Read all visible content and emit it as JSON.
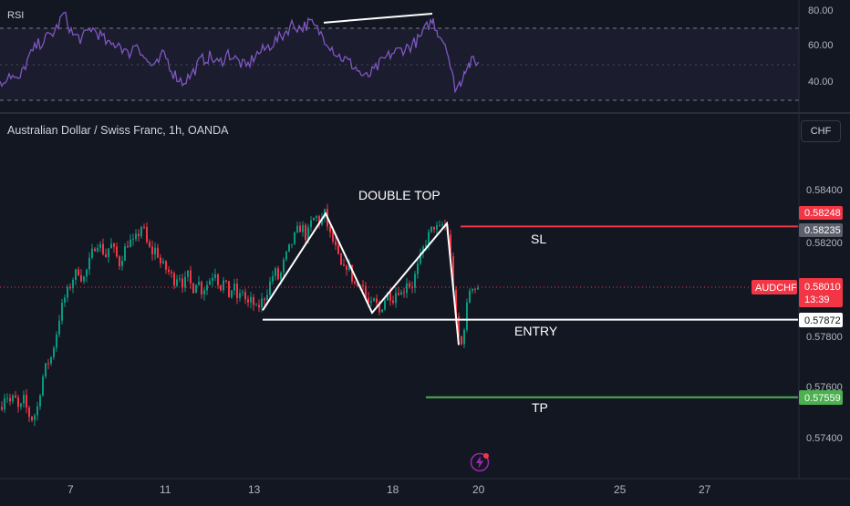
{
  "header": {
    "title": "Australian Dollar / Swiss Franc, 1h, OANDA",
    "currency_button": "CHF"
  },
  "rsi": {
    "label": "RSI",
    "ticks": [
      "80.00",
      "60.00",
      "40.00"
    ]
  },
  "price_axis": {
    "ticks": [
      "0.58400",
      "0.58200",
      "0.58000",
      "0.57800",
      "0.57600",
      "0.57400"
    ]
  },
  "price_tags": {
    "sl": {
      "value": "0.58248",
      "color": "#f23645"
    },
    "prev": {
      "value": "0.58235",
      "color": "#5d606b"
    },
    "current": {
      "symbol": "AUDCHF",
      "value": "0.58010",
      "countdown": "13:39",
      "color": "#f23645"
    },
    "entry": {
      "value": "0.57872"
    },
    "tp": {
      "value": "0.57559",
      "color": "#4caf50"
    }
  },
  "annotations": {
    "pattern": "DOUBLE TOP",
    "sl": "SL",
    "entry": "ENTRY",
    "tp": "TP"
  },
  "date_axis": {
    "ticks": [
      "7",
      "11",
      "13",
      "18",
      "20",
      "25",
      "27"
    ]
  },
  "colors": {
    "background": "#131722",
    "up": "#089981",
    "up_alt": "#26a69a",
    "down": "#f23645",
    "rsi_line": "#7e57c2",
    "rsi_band": "#7e57c2"
  },
  "icons": {
    "bolt": "lightning-bolt-icon"
  },
  "chart_data": {
    "type": "candlestick",
    "symbol": "AUDCHF",
    "timeframe": "1h",
    "source": "OANDA",
    "x_ticks": [
      "7",
      "11",
      "13",
      "18",
      "20",
      "25",
      "27"
    ],
    "ylim": [
      0.5732,
      0.585
    ],
    "price_path": [
      [
        0,
        0.5752
      ],
      [
        5,
        0.5758
      ],
      [
        10,
        0.5754
      ],
      [
        15,
        0.5756
      ],
      [
        20,
        0.575
      ],
      [
        25,
        0.5755
      ],
      [
        30,
        0.5749
      ],
      [
        35,
        0.5747
      ],
      [
        40,
        0.5752
      ],
      [
        45,
        0.5763
      ],
      [
        50,
        0.5769
      ],
      [
        55,
        0.5772
      ],
      [
        60,
        0.578
      ],
      [
        65,
        0.579
      ],
      [
        70,
        0.5796
      ],
      [
        75,
        0.58
      ],
      [
        80,
        0.5805
      ],
      [
        85,
        0.5807
      ],
      [
        90,
        0.5803
      ],
      [
        95,
        0.5808
      ],
      [
        100,
        0.5814
      ],
      [
        105,
        0.5819
      ],
      [
        110,
        0.5816
      ],
      [
        115,
        0.5813
      ],
      [
        120,
        0.5818
      ],
      [
        125,
        0.5814
      ],
      [
        130,
        0.581
      ],
      [
        135,
        0.5815
      ],
      [
        140,
        0.5819
      ],
      [
        145,
        0.5818
      ],
      [
        150,
        0.5821
      ],
      [
        155,
        0.5826
      ],
      [
        160,
        0.5818
      ],
      [
        165,
        0.5814
      ],
      [
        170,
        0.5816
      ],
      [
        175,
        0.581
      ],
      [
        180,
        0.5808
      ],
      [
        185,
        0.5806
      ],
      [
        190,
        0.5803
      ],
      [
        195,
        0.5806
      ],
      [
        200,
        0.5801
      ],
      [
        205,
        0.5805
      ],
      [
        210,
        0.5799
      ],
      [
        215,
        0.5804
      ],
      [
        220,
        0.5799
      ],
      [
        225,
        0.5801
      ],
      [
        230,
        0.5804
      ],
      [
        235,
        0.5807
      ],
      [
        240,
        0.58
      ],
      [
        245,
        0.5803
      ],
      [
        250,
        0.5797
      ],
      [
        255,
        0.5801
      ],
      [
        260,
        0.5795
      ],
      [
        265,
        0.5799
      ],
      [
        270,
        0.5793
      ],
      [
        275,
        0.5795
      ],
      [
        280,
        0.5791
      ],
      [
        285,
        0.5794
      ],
      [
        290,
        0.5797
      ],
      [
        295,
        0.5802
      ],
      [
        300,
        0.5807
      ],
      [
        305,
        0.5803
      ],
      [
        310,
        0.581
      ],
      [
        315,
        0.5815
      ],
      [
        320,
        0.5819
      ],
      [
        325,
        0.5823
      ],
      [
        330,
        0.5825
      ],
      [
        335,
        0.582
      ],
      [
        340,
        0.5826
      ],
      [
        345,
        0.5829
      ],
      [
        350,
        0.5826
      ],
      [
        355,
        0.583
      ],
      [
        360,
        0.5822
      ],
      [
        365,
        0.5818
      ],
      [
        370,
        0.5812
      ],
      [
        375,
        0.5806
      ],
      [
        380,
        0.581
      ],
      [
        385,
        0.5804
      ],
      [
        390,
        0.58
      ],
      [
        395,
        0.5804
      ],
      [
        400,
        0.5796
      ],
      [
        405,
        0.5792
      ],
      [
        410,
        0.5795
      ],
      [
        415,
        0.579
      ],
      [
        420,
        0.5795
      ],
      [
        425,
        0.5798
      ],
      [
        430,
        0.5796
      ],
      [
        435,
        0.58
      ],
      [
        440,
        0.5797
      ],
      [
        445,
        0.5803
      ],
      [
        450,
        0.58
      ],
      [
        455,
        0.5806
      ],
      [
        460,
        0.5812
      ],
      [
        465,
        0.5818
      ],
      [
        470,
        0.5822
      ],
      [
        475,
        0.5825
      ],
      [
        480,
        0.5823
      ],
      [
        485,
        0.5826
      ],
      [
        490,
        0.5822
      ],
      [
        495,
        0.5805
      ],
      [
        500,
        0.5782
      ],
      [
        505,
        0.5777
      ],
      [
        510,
        0.579
      ],
      [
        515,
        0.5802
      ],
      [
        520,
        0.58
      ],
      [
        525,
        0.5801
      ]
    ],
    "pattern_lines": {
      "double_top": [
        [
          288,
          0.5791
        ],
        [
          357,
          0.583
        ],
        [
          408,
          0.579
        ],
        [
          490,
          0.5826
        ],
        [
          503,
          0.5777
        ]
      ],
      "entry_line": [
        [
          288,
          0.57872
        ],
        [
          875,
          0.57872
        ]
      ],
      "sl_line": [
        [
          505,
          0.58248
        ],
        [
          875,
          0.58248
        ]
      ],
      "tp_line": [
        [
          467,
          0.57559
        ],
        [
          875,
          0.57559
        ]
      ]
    },
    "rsi": {
      "ylim": [
        30,
        85
      ],
      "upper_band": 70,
      "lower_band": 30,
      "values": [
        [
          0,
          38
        ],
        [
          10,
          45
        ],
        [
          20,
          40
        ],
        [
          30,
          52
        ],
        [
          40,
          60
        ],
        [
          50,
          64
        ],
        [
          60,
          68
        ],
        [
          70,
          78
        ],
        [
          80,
          66
        ],
        [
          90,
          64
        ],
        [
          100,
          70
        ],
        [
          110,
          66
        ],
        [
          120,
          60
        ],
        [
          130,
          62
        ],
        [
          140,
          55
        ],
        [
          150,
          62
        ],
        [
          160,
          52
        ],
        [
          170,
          48
        ],
        [
          180,
          56
        ],
        [
          190,
          45
        ],
        [
          200,
          40
        ],
        [
          210,
          44
        ],
        [
          220,
          52
        ],
        [
          230,
          54
        ],
        [
          240,
          50
        ],
        [
          250,
          56
        ],
        [
          260,
          52
        ],
        [
          270,
          48
        ],
        [
          280,
          55
        ],
        [
          290,
          58
        ],
        [
          300,
          62
        ],
        [
          310,
          66
        ],
        [
          320,
          72
        ],
        [
          330,
          70
        ],
        [
          340,
          73
        ],
        [
          350,
          68
        ],
        [
          360,
          62
        ],
        [
          370,
          55
        ],
        [
          380,
          52
        ],
        [
          390,
          48
        ],
        [
          400,
          42
        ],
        [
          410,
          46
        ],
        [
          420,
          52
        ],
        [
          430,
          56
        ],
        [
          440,
          58
        ],
        [
          450,
          60
        ],
        [
          460,
          64
        ],
        [
          470,
          72
        ],
        [
          475,
          74
        ],
        [
          480,
          68
        ],
        [
          490,
          60
        ],
        [
          495,
          45
        ],
        [
          500,
          36
        ],
        [
          505,
          40
        ],
        [
          510,
          48
        ],
        [
          515,
          50
        ],
        [
          520,
          52
        ],
        [
          525,
          51
        ]
      ],
      "divergence_line": [
        [
          355,
          73
        ],
        [
          474,
          78
        ]
      ]
    }
  }
}
